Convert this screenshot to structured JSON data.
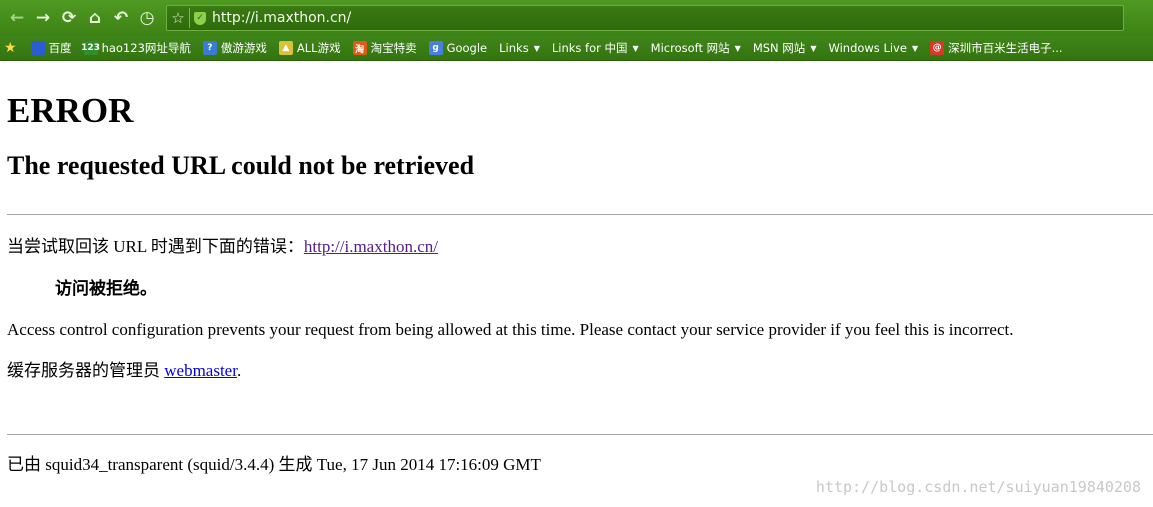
{
  "browser": {
    "address": {
      "url": "http://i.maxthon.cn/"
    },
    "bookmarks": [
      {
        "label": "百度",
        "icon": "baidu-paw-icon",
        "color": "#2d5bd3",
        "glyph": "🐾",
        "caret": false
      },
      {
        "label": "hao123网址导航",
        "icon": "hao123-icon",
        "color": "#2f8f2a",
        "glyph": "123",
        "caret": false
      },
      {
        "label": "傲游游戏",
        "icon": "maxthon-game-icon",
        "color": "#3a7bd5",
        "glyph": "?",
        "caret": false
      },
      {
        "label": "ALL游戏",
        "icon": "game-icon",
        "color": "#d8c23a",
        "glyph": "▲",
        "caret": false
      },
      {
        "label": "淘宝特卖",
        "icon": "taobao-icon",
        "color": "#e25a16",
        "glyph": "淘",
        "caret": false
      },
      {
        "label": "Google",
        "icon": "google-icon",
        "color": "#4a7fe0",
        "glyph": "g",
        "caret": false
      },
      {
        "label": "Links",
        "icon": "",
        "color": "",
        "glyph": "",
        "caret": true
      },
      {
        "label": "Links for 中国",
        "icon": "",
        "color": "",
        "glyph": "",
        "caret": true
      },
      {
        "label": "Microsoft 网站",
        "icon": "",
        "color": "",
        "glyph": "",
        "caret": true
      },
      {
        "label": "MSN 网站",
        "icon": "",
        "color": "",
        "glyph": "",
        "caret": true
      },
      {
        "label": "Windows Live",
        "icon": "",
        "color": "",
        "glyph": "",
        "caret": true
      },
      {
        "label": "深圳市百米生活电子...",
        "icon": "at-icon",
        "color": "#d83a2a",
        "glyph": "@",
        "caret": false
      }
    ]
  },
  "page": {
    "h1": "ERROR",
    "h2": "The requested URL could not be retrieved",
    "attempt_prefix": "当尝试取回该 URL 时遇到下面的错误：",
    "attempt_link": "http://i.maxthon.cn/",
    "error_title": "访问被拒绝。",
    "explanation": "Access control configuration prevents your request from being allowed at this time. Please contact your service provider if you feel this is incorrect.",
    "admin_prefix": "缓存服务器的管理员 ",
    "admin_link": "webmaster",
    "admin_suffix": ".",
    "footer": "已由 squid34_transparent (squid/3.4.4) 生成 Tue, 17 Jun 2014 17:16:09 GMT"
  },
  "watermark": "http://blog.csdn.net/suiyuan19840208"
}
